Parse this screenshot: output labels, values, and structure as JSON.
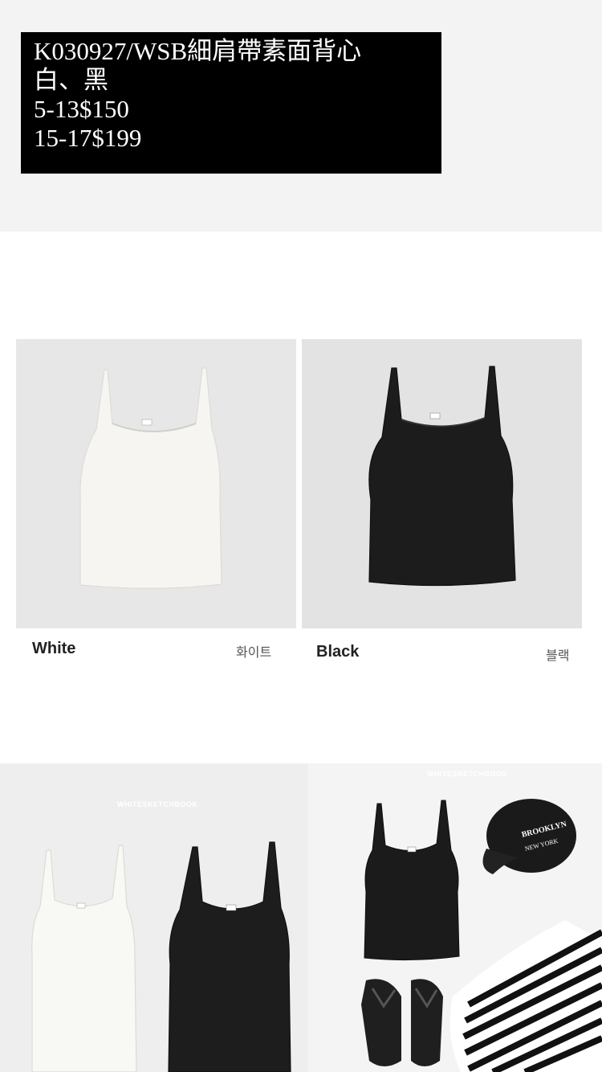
{
  "product": {
    "title_line": "K030927/WSB細肩帶素面背心",
    "colors_line": "白、黑",
    "price_small": "5-13$150",
    "price_large": "15-17$199"
  },
  "swatches": [
    {
      "name_en": "White",
      "name_ko": "화이트",
      "fill": "#f6f5f1"
    },
    {
      "name_en": "Black",
      "name_ko": "블랙",
      "fill": "#1c1c1c"
    }
  ],
  "watermarks": {
    "left": "WHITESKETCHBOOK",
    "right": "WHITESKETCHBOOK"
  },
  "cap_text": {
    "line1": "BROOKLYN",
    "line2": "NEW YORK"
  }
}
